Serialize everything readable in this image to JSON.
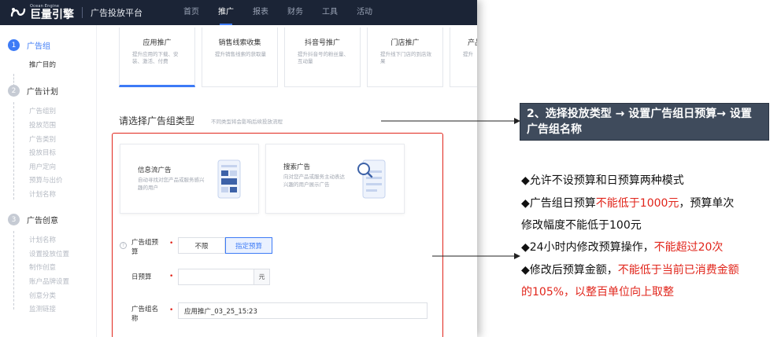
{
  "topbar": {
    "logo_en": "Ocean Engine",
    "logo_cn": "巨量引擎",
    "platform": "广告投放平台",
    "nav": [
      "首页",
      "推广",
      "报表",
      "财务",
      "工具",
      "活动"
    ]
  },
  "sidebar": {
    "steps": [
      {
        "num": "1",
        "title": "广告组",
        "subs": [
          "推广目的"
        ]
      },
      {
        "num": "2",
        "title": "广告计划",
        "subs": [
          "广告组别",
          "投放范围",
          "广告类别",
          "投放目标",
          "用户定向",
          "预算与出价",
          "计划名称"
        ]
      },
      {
        "num": "3",
        "title": "广告创意",
        "subs": [
          "计划名称",
          "设置投放位置",
          "制作创意",
          "账户品牌设置",
          "创意分类",
          "监测链接"
        ]
      }
    ]
  },
  "promo_cards": [
    {
      "name": "应用推广",
      "desc": "提升应用的下载、安装、激活、付费"
    },
    {
      "name": "销售线索收集",
      "desc": "提升销售线索的获取量"
    },
    {
      "name": "抖音号推广",
      "desc": "提升抖音号的粉丝量、互动量"
    },
    {
      "name": "门店推广",
      "desc": "提升线下门店的到店效果"
    },
    {
      "name": "产品",
      "desc": "提升"
    }
  ],
  "group_type": {
    "title": "请选择广告组类型",
    "hint": "不同类型将会影响后续投放流程",
    "cards": [
      {
        "name": "信息流广告",
        "desc": "自动寻找对您产品或服务感兴趣的用户"
      },
      {
        "name": "搜索广告",
        "desc": "向对您产品或服务主动表达兴趣的用户展示广告"
      }
    ]
  },
  "form": {
    "budget_label": "广告组预算",
    "budget_options": [
      "不限",
      "指定预算"
    ],
    "daily_label": "日预算",
    "daily_value": "",
    "unit": "元",
    "name_label": "广告组名称",
    "name_value": "应用推广_03_25_15:23",
    "required_mark": "•",
    "help": "?"
  },
  "annotation": {
    "callout": "2、选择投放类型 → 设置广告组日预算→ 设置广告组名称",
    "notes": [
      {
        "parts": [
          {
            "t": "◆允许不设预算和日预算两种模式",
            "hl": false
          }
        ]
      },
      {
        "parts": [
          {
            "t": "◆广告组日预算",
            "hl": false
          },
          {
            "t": "不能低于1000元",
            "hl": true
          },
          {
            "t": "，预算单次",
            "hl": false
          }
        ]
      },
      {
        "parts": [
          {
            "t": "修改幅度不能低于100元",
            "hl": false
          }
        ]
      },
      {
        "parts": [
          {
            "t": "◆24小时内修改预算操作，",
            "hl": false
          },
          {
            "t": "不能超过20次",
            "hl": true
          }
        ]
      },
      {
        "parts": [
          {
            "t": "◆修改后预算金额，",
            "hl": false
          },
          {
            "t": "不能低于当前已消费金额",
            "hl": true
          }
        ]
      },
      {
        "parts": [
          {
            "t": "的105%，以整百单位向上取整",
            "hl": true
          }
        ]
      }
    ]
  },
  "colors": {
    "accent": "#3d7bf6",
    "highlight": "#e1251b",
    "topbar": "#1b2436",
    "callout_bg": "#3f4b5c"
  }
}
